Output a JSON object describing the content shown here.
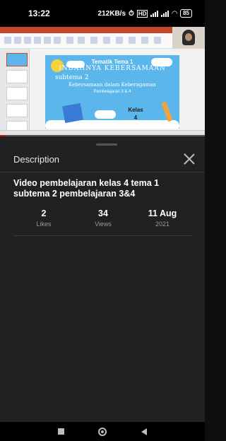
{
  "status_bar": {
    "time": "13:22",
    "net_speed": "212KB/s",
    "battery": "85"
  },
  "video": {
    "slide": {
      "tema_line": "Tematik Tema  1",
      "title_line": "INDAHNYA KEBERSAMAAN",
      "subtema_line": "subtema 2",
      "subtitle_line": "Kebersamaan dalam Keberagaman",
      "pembelajaran_line": "Pembelajaran 3 & 4",
      "kelas_label": "Kelas",
      "kelas_number": "4"
    },
    "playback_progress": 0.02,
    "accent_color": "#ff0000"
  },
  "description_panel": {
    "title": "Description",
    "video_title": "Video pembelajaran kelas 4 tema 1 subtema 2 pembelajaran 3&4",
    "stats": [
      {
        "value": "2",
        "label": "Likes"
      },
      {
        "value": "34",
        "label": "Views"
      },
      {
        "value": "11 Aug",
        "label": "2021"
      }
    ]
  },
  "icons": {
    "close": "close-icon",
    "nav_recents": "square-icon",
    "nav_home": "circle-icon",
    "nav_back": "triangle-back-icon"
  }
}
